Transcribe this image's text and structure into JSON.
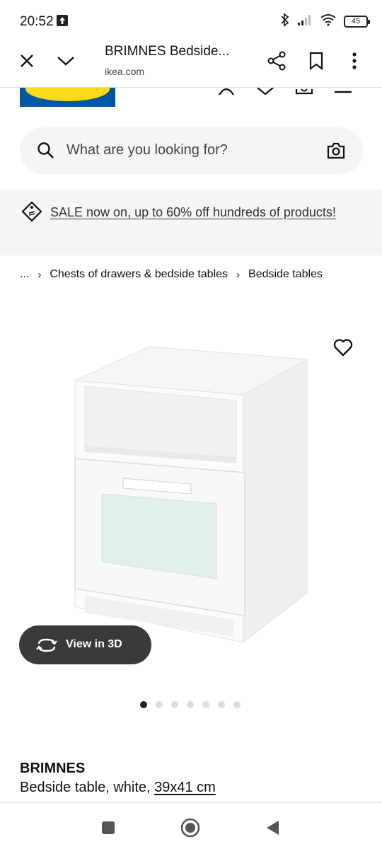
{
  "status_bar": {
    "time": "20:52",
    "battery": "45"
  },
  "browser": {
    "title": "BRIMNES Bedside...",
    "domain": "ikea.com"
  },
  "search": {
    "placeholder": "What are you looking for?"
  },
  "banner": {
    "text": "SALE now on, up to 60% off hundreds of products!"
  },
  "breadcrumb": {
    "items": [
      "...",
      "Chests of drawers & bedside tables",
      "Bedside tables"
    ]
  },
  "gallery": {
    "view_3d_label": "View in 3D",
    "image_count": 7,
    "active_index": 0
  },
  "product": {
    "name": "BRIMNES",
    "description": "Bedside table, white,",
    "size": "39x41 cm"
  },
  "colors": {
    "ikea_blue": "#0058a3",
    "ikea_yellow": "#ffda1a",
    "button_dark": "#3a3a3a"
  }
}
